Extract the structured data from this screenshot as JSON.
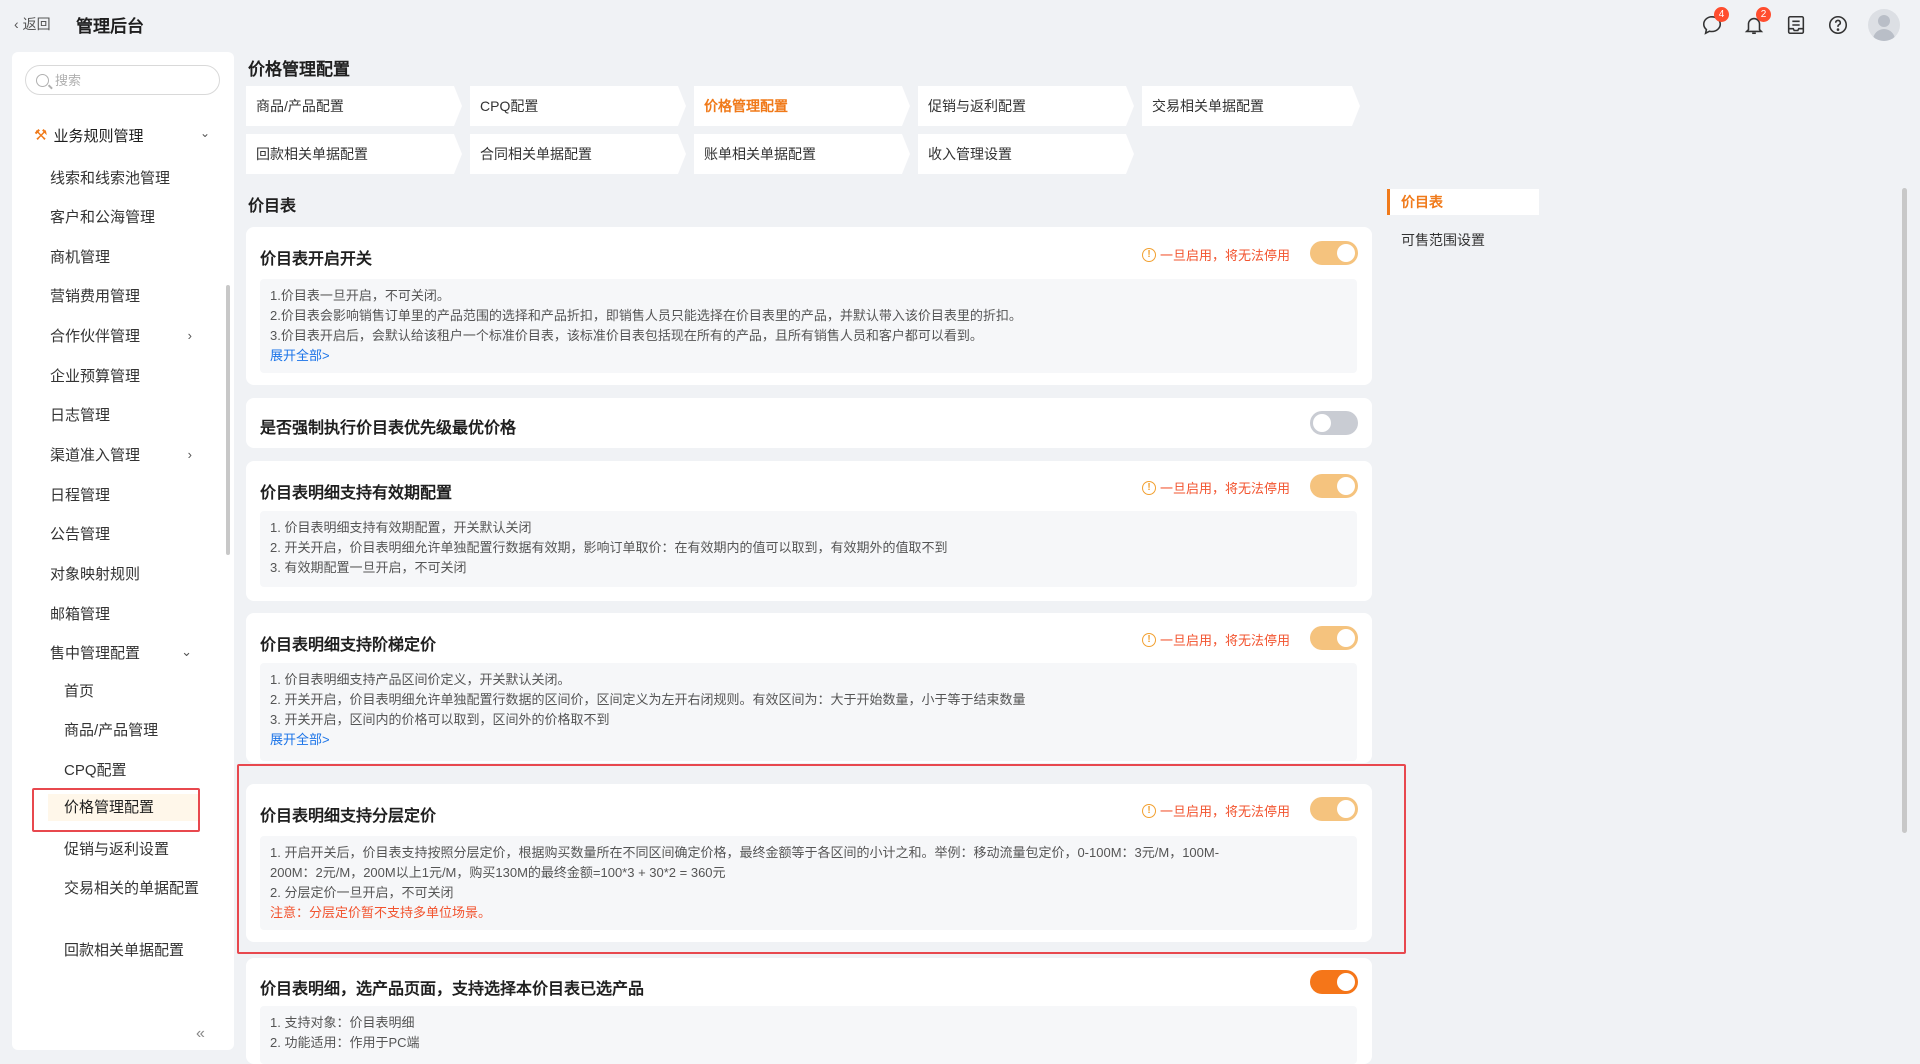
{
  "header": {
    "back_label": "返回",
    "app_title": "管理后台",
    "messages_badge": "4",
    "notifications_badge": "2"
  },
  "sidebar": {
    "search_placeholder": "搜索",
    "group_label": "业务规则管理",
    "items": [
      {
        "label": "线索和线索池管理"
      },
      {
        "label": "客户和公海管理"
      },
      {
        "label": "商机管理"
      },
      {
        "label": "营销费用管理"
      },
      {
        "label": "合作伙伴管理"
      },
      {
        "label": "企业预算管理"
      },
      {
        "label": "日志管理"
      },
      {
        "label": "渠道准入管理"
      },
      {
        "label": "日程管理"
      },
      {
        "label": "公告管理"
      },
      {
        "label": "对象映射规则"
      },
      {
        "label": "邮箱管理"
      },
      {
        "label": "售中管理配置"
      }
    ],
    "sub_items": [
      {
        "label": "首页"
      },
      {
        "label": "商品/产品管理"
      },
      {
        "label": "CPQ配置"
      },
      {
        "label": "价格管理配置"
      },
      {
        "label": "促销与返利设置"
      },
      {
        "label": "交易相关的单据配置"
      },
      {
        "label": "回款相关单据配置"
      }
    ]
  },
  "main": {
    "page_title": "价格管理配置",
    "tabs": [
      {
        "label": "商品/产品配置"
      },
      {
        "label": "CPQ配置"
      },
      {
        "label": "价格管理配置"
      },
      {
        "label": "促销与返利配置"
      },
      {
        "label": "交易相关单据配置"
      },
      {
        "label": "回款相关单据配置"
      },
      {
        "label": "合同相关单据配置"
      },
      {
        "label": "账单相关单据配置"
      },
      {
        "label": "收入管理设置"
      }
    ],
    "section_title": "价目表",
    "cards": [
      {
        "title": "价目表开启开关",
        "warning": "一旦启用，将无法停用",
        "lines": [
          "1.价目表一旦开启，不可关闭。",
          "2.价目表会影响销售订单里的产品范围的选择和产品折扣，即销售人员只能选择在价目表里的产品，并默认带入该价目表里的折扣。",
          "3.价目表开启后，会默认给该租户一个标准价目表，该标准价目表包括现在所有的产品，且所有销售人员和客户都可以看到。"
        ],
        "more": "展开全部>"
      },
      {
        "title": "是否强制执行价目表优先级最优价格"
      },
      {
        "title": "价目表明细支持有效期配置",
        "warning": "一旦启用，将无法停用",
        "lines": [
          "1. 价目表明细支持有效期配置，开关默认关闭",
          "2. 开关开启，价目表明细允许单独配置行数据有效期，影响订单取价：在有效期内的值可以取到，有效期外的值取不到",
          "3. 有效期配置一旦开启，不可关闭"
        ]
      },
      {
        "title": "价目表明细支持阶梯定价",
        "warning": "一旦启用，将无法停用",
        "lines": [
          "1. 价目表明细支持产品区间价定义，开关默认关闭。",
          "2. 开关开启，价目表明细允许单独配置行数据的区间价，区间定义为左开右闭规则。有效区间为：大于开始数量，小于等于结束数量",
          "3. 开关开启，区间内的价格可以取到，区间外的价格取不到"
        ],
        "more": "展开全部>"
      },
      {
        "title": "价目表明细支持分层定价",
        "warning": "一旦启用，将无法停用",
        "lines": [
          "1. 开启开关后，价目表支持按照分层定价，根据购买数量所在不同区间确定价格，最终金额等于各区间的小计之和。举例：移动流量包定价，0-100M：3元/M，100M-",
          "200M：2元/M，200M以上1元/M，购买130M的最终金额=100*3 + 30*2 = 360元",
          "2. 分层定价一旦开启，不可关闭"
        ],
        "note": "注意：分层定价暂不支持多单位场景。"
      },
      {
        "title": "价目表明细，选产品页面，支持选择本价目表已选产品",
        "lines": [
          "1. 支持对象：价目表明细",
          "2. 功能适用：作用于PC端"
        ]
      }
    ]
  },
  "anchors": [
    {
      "label": "价目表"
    },
    {
      "label": "可售范围设置"
    }
  ],
  "colors": {
    "accent": "#f07a1a",
    "warning_text": "#f2532e",
    "highlight_border": "#e8484e",
    "link": "#1a73e8"
  }
}
